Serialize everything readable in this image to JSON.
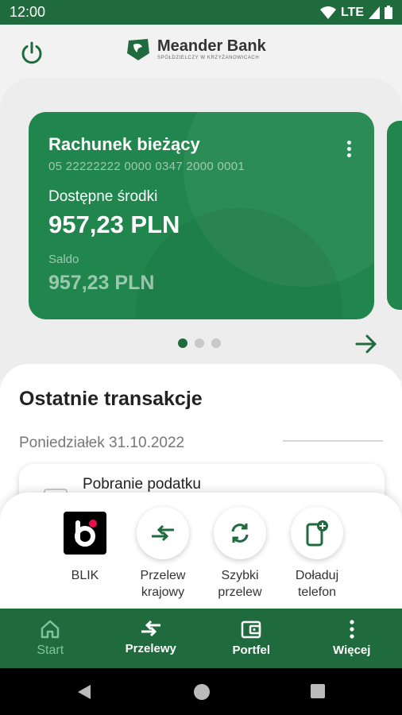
{
  "status": {
    "time": "12:00",
    "network": "LTE"
  },
  "header": {
    "logo_name": "Meander Bank",
    "logo_sub": "SPÓŁDZIELCZY W KRZYŻANOWICACH"
  },
  "account": {
    "name": "Rachunek bieżący",
    "number": "05 22222222 0000 0347 2000 0001",
    "available_label": "Dostępne środki",
    "available": "957,23 PLN",
    "saldo_label": "Saldo",
    "saldo": "957,23 PLN"
  },
  "carousel": {
    "pages": 3,
    "active": 1
  },
  "transactions": {
    "title": "Ostatnie transakcje",
    "date": "Poniedziałek 31.10.2022",
    "items": [
      {
        "name": "Pobranie podatku"
      }
    ]
  },
  "quick_actions": {
    "blik": "BLIK",
    "domestic": "Przelew krajowy",
    "fast": "Szybki przelew",
    "topup": "Doładuj telefon"
  },
  "nav": {
    "start": "Start",
    "transfers": "Przelewy",
    "wallet": "Portfel",
    "more": "Więcej"
  },
  "colors": {
    "primary": "#1f6b3e",
    "card": "#21864d",
    "accent_light": "#7fc39b",
    "blik_dot": "#e8104a"
  }
}
